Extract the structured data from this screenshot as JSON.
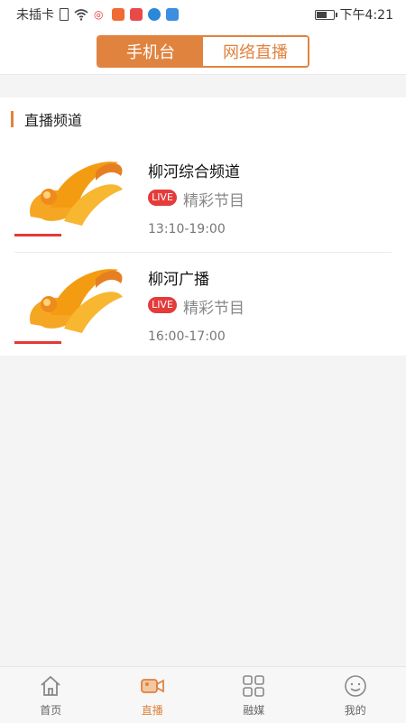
{
  "status_bar": {
    "carrier": "未插卡",
    "time": "下午4:21",
    "battery_level": 0.7
  },
  "header": {
    "tabs": [
      {
        "label": "手机台",
        "active": true
      },
      {
        "label": "网络直播",
        "active": false
      }
    ]
  },
  "section": {
    "title": "直播频道"
  },
  "channels": [
    {
      "name": "柳河综合频道",
      "badge": "LIVE",
      "program": "精彩节目",
      "time": "13:10-19:00"
    },
    {
      "name": "柳河广播",
      "badge": "LIVE",
      "program": "精彩节目",
      "time": "16:00-17:00"
    }
  ],
  "bottom_nav": {
    "items": [
      {
        "label": "首页",
        "icon": "home-icon",
        "active": false
      },
      {
        "label": "直播",
        "icon": "video-camera-icon",
        "active": true
      },
      {
        "label": "融媒",
        "icon": "grid-icon",
        "active": false
      },
      {
        "label": "我的",
        "icon": "smiley-icon",
        "active": false
      }
    ]
  },
  "colors": {
    "accent": "#e0833f",
    "live_red": "#e53b3b",
    "background": "#f4f4f4"
  }
}
